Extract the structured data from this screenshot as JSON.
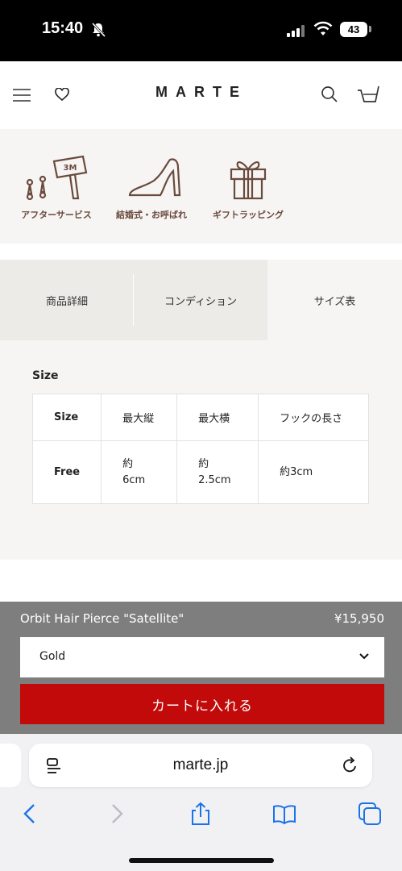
{
  "status_bar": {
    "time": "15:40",
    "battery": "43"
  },
  "header": {
    "logo": "MARTE"
  },
  "services": [
    {
      "label": "アフターサービス",
      "sign_text": "3M"
    },
    {
      "label": "結婚式・お呼ばれ"
    },
    {
      "label": "ギフトラッピング"
    }
  ],
  "tabs": [
    {
      "label": "商品詳細"
    },
    {
      "label": "コンディション"
    },
    {
      "label": "サイズ表"
    }
  ],
  "size_chart": {
    "title": "Size",
    "headers": [
      "Size",
      "最大縦",
      "最大横",
      "フックの長さ"
    ],
    "rows": [
      {
        "label": "Free",
        "height_prefix": "約",
        "height": "6cm",
        "width_prefix": "約",
        "width": "2.5cm",
        "hook": "約3cm"
      }
    ]
  },
  "purchase": {
    "product_name": "Orbit Hair Pierce \"Satellite\"",
    "price": "¥15,950",
    "selected_option": "Gold",
    "cart_button": "カートに入れる"
  },
  "browser": {
    "url": "marte.jp"
  },
  "colors": {
    "accent_red": "#c20a0a",
    "icon_brown": "#6b4a3e",
    "ios_blue": "#1a73e8"
  }
}
